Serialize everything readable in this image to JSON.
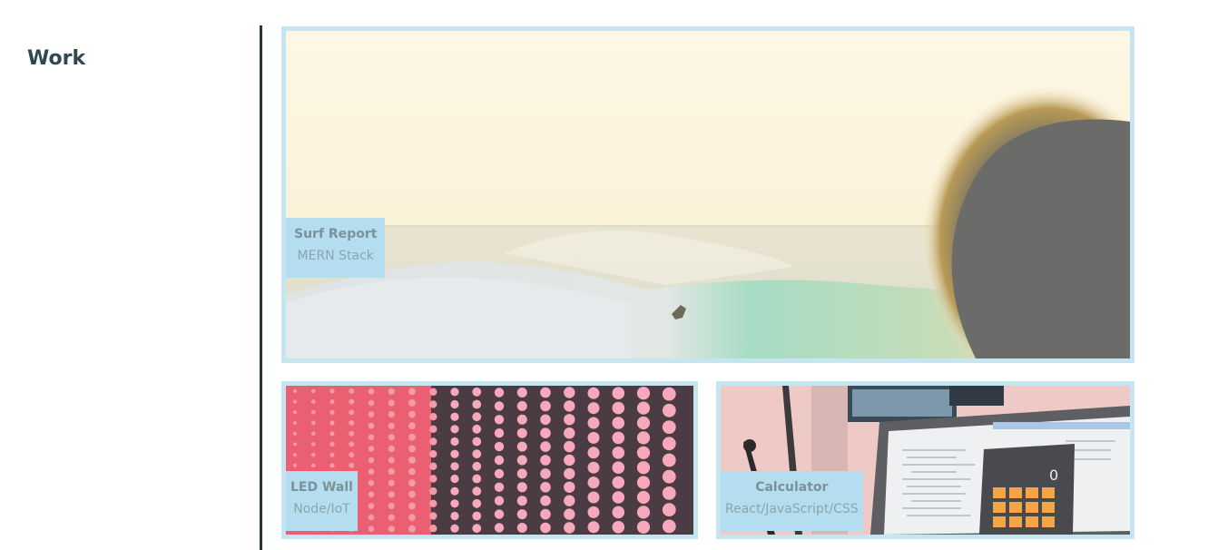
{
  "section": {
    "title": "Work"
  },
  "projects": [
    {
      "name": "Surf Report",
      "tech": "MERN Stack"
    },
    {
      "name": "LED Wall",
      "tech": "Node/IoT"
    },
    {
      "name": "Calculator",
      "tech": "React/JavaScript/CSS"
    }
  ],
  "calculator_display": "0",
  "colors": {
    "card_border": "#c5e6f1",
    "label_bg": "#b4def0",
    "title": "#2e4a4f",
    "divider": "#25393b",
    "led_wall": "#f0707e"
  }
}
